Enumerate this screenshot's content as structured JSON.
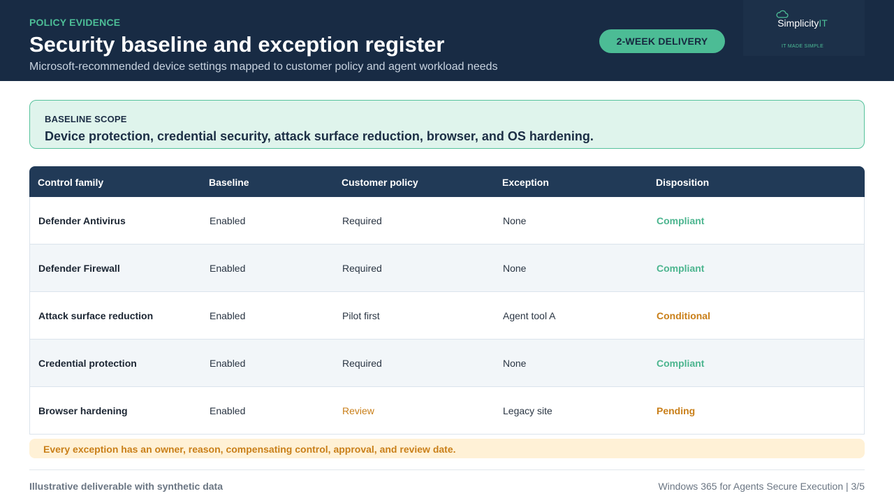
{
  "header": {
    "eyebrow": "POLICY EVIDENCE",
    "title": "Security baseline and exception register",
    "subtitle": "Microsoft-recommended device settings mapped to customer policy and agent workload needs",
    "pill": "2-WEEK DELIVERY",
    "logo": {
      "word": "Simplicity",
      "word_accent": "IT",
      "tagline": "IT MADE SIMPLE",
      "icon": "cloud-icon"
    }
  },
  "scope": {
    "label": "BASELINE SCOPE",
    "text": "Device protection, credential security, attack surface reduction, browser, and OS hardening."
  },
  "table": {
    "columns": [
      "Control family",
      "Baseline",
      "Customer policy",
      "Exception",
      "Disposition"
    ],
    "rows": [
      {
        "control": "Defender Antivirus",
        "baseline": "Enabled",
        "policy": "Required",
        "exception": "None",
        "disposition": "Compliant",
        "status": "ok"
      },
      {
        "control": "Defender Firewall",
        "baseline": "Enabled",
        "policy": "Required",
        "exception": "None",
        "disposition": "Compliant",
        "status": "ok"
      },
      {
        "control": "Attack surface reduction",
        "baseline": "Enabled",
        "policy": "Pilot first",
        "exception": "Agent tool A",
        "disposition": "Conditional",
        "status": "warn"
      },
      {
        "control": "Credential protection",
        "baseline": "Enabled",
        "policy": "Required",
        "exception": "None",
        "disposition": "Compliant",
        "status": "ok"
      },
      {
        "control": "Browser hardening",
        "baseline": "Enabled",
        "policy": "Review",
        "policy_status": "warn",
        "exception": "Legacy site",
        "disposition": "Pending",
        "status": "warn"
      }
    ]
  },
  "note": "Every exception has an owner, reason, compensating control, approval, and review date.",
  "footer": {
    "left": "Illustrative deliverable with synthetic data",
    "right": "Windows 365 for Agents Secure Execution | 3/5"
  },
  "colors": {
    "header_bg": "#182b44",
    "accent_green": "#4cbc95",
    "status_ok": "#4cb58f",
    "status_warn": "#c97f19",
    "table_header_bg": "#213a57"
  }
}
